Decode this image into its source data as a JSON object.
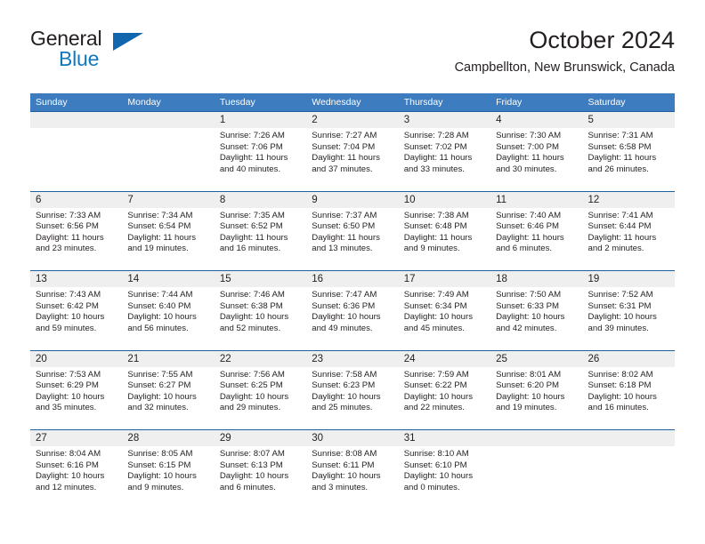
{
  "brand": {
    "word_one": "General",
    "word_two": "Blue",
    "triangle_icon": "triangle-icon",
    "accent_dark": "#1266ae",
    "accent_blue": "#1278be"
  },
  "header": {
    "title": "October 2024",
    "subtitle": "Campbellton, New Brunswick, Canada"
  },
  "theme": {
    "header_blue": "#3c7cbf",
    "row_divider_blue": "#1f5fa0",
    "daynum_band_gray": "#efefef",
    "text": "#231f20"
  },
  "weekdays": [
    "Sunday",
    "Monday",
    "Tuesday",
    "Wednesday",
    "Thursday",
    "Friday",
    "Saturday"
  ],
  "weeks": [
    [
      {
        "day": "",
        "sunrise": "",
        "sunset": "",
        "daylight1": "",
        "daylight2": ""
      },
      {
        "day": "",
        "sunrise": "",
        "sunset": "",
        "daylight1": "",
        "daylight2": ""
      },
      {
        "day": "1",
        "sunrise": "Sunrise: 7:26 AM",
        "sunset": "Sunset: 7:06 PM",
        "daylight1": "Daylight: 11 hours",
        "daylight2": "and 40 minutes."
      },
      {
        "day": "2",
        "sunrise": "Sunrise: 7:27 AM",
        "sunset": "Sunset: 7:04 PM",
        "daylight1": "Daylight: 11 hours",
        "daylight2": "and 37 minutes."
      },
      {
        "day": "3",
        "sunrise": "Sunrise: 7:28 AM",
        "sunset": "Sunset: 7:02 PM",
        "daylight1": "Daylight: 11 hours",
        "daylight2": "and 33 minutes."
      },
      {
        "day": "4",
        "sunrise": "Sunrise: 7:30 AM",
        "sunset": "Sunset: 7:00 PM",
        "daylight1": "Daylight: 11 hours",
        "daylight2": "and 30 minutes."
      },
      {
        "day": "5",
        "sunrise": "Sunrise: 7:31 AM",
        "sunset": "Sunset: 6:58 PM",
        "daylight1": "Daylight: 11 hours",
        "daylight2": "and 26 minutes."
      }
    ],
    [
      {
        "day": "6",
        "sunrise": "Sunrise: 7:33 AM",
        "sunset": "Sunset: 6:56 PM",
        "daylight1": "Daylight: 11 hours",
        "daylight2": "and 23 minutes."
      },
      {
        "day": "7",
        "sunrise": "Sunrise: 7:34 AM",
        "sunset": "Sunset: 6:54 PM",
        "daylight1": "Daylight: 11 hours",
        "daylight2": "and 19 minutes."
      },
      {
        "day": "8",
        "sunrise": "Sunrise: 7:35 AM",
        "sunset": "Sunset: 6:52 PM",
        "daylight1": "Daylight: 11 hours",
        "daylight2": "and 16 minutes."
      },
      {
        "day": "9",
        "sunrise": "Sunrise: 7:37 AM",
        "sunset": "Sunset: 6:50 PM",
        "daylight1": "Daylight: 11 hours",
        "daylight2": "and 13 minutes."
      },
      {
        "day": "10",
        "sunrise": "Sunrise: 7:38 AM",
        "sunset": "Sunset: 6:48 PM",
        "daylight1": "Daylight: 11 hours",
        "daylight2": "and 9 minutes."
      },
      {
        "day": "11",
        "sunrise": "Sunrise: 7:40 AM",
        "sunset": "Sunset: 6:46 PM",
        "daylight1": "Daylight: 11 hours",
        "daylight2": "and 6 minutes."
      },
      {
        "day": "12",
        "sunrise": "Sunrise: 7:41 AM",
        "sunset": "Sunset: 6:44 PM",
        "daylight1": "Daylight: 11 hours",
        "daylight2": "and 2 minutes."
      }
    ],
    [
      {
        "day": "13",
        "sunrise": "Sunrise: 7:43 AM",
        "sunset": "Sunset: 6:42 PM",
        "daylight1": "Daylight: 10 hours",
        "daylight2": "and 59 minutes."
      },
      {
        "day": "14",
        "sunrise": "Sunrise: 7:44 AM",
        "sunset": "Sunset: 6:40 PM",
        "daylight1": "Daylight: 10 hours",
        "daylight2": "and 56 minutes."
      },
      {
        "day": "15",
        "sunrise": "Sunrise: 7:46 AM",
        "sunset": "Sunset: 6:38 PM",
        "daylight1": "Daylight: 10 hours",
        "daylight2": "and 52 minutes."
      },
      {
        "day": "16",
        "sunrise": "Sunrise: 7:47 AM",
        "sunset": "Sunset: 6:36 PM",
        "daylight1": "Daylight: 10 hours",
        "daylight2": "and 49 minutes."
      },
      {
        "day": "17",
        "sunrise": "Sunrise: 7:49 AM",
        "sunset": "Sunset: 6:34 PM",
        "daylight1": "Daylight: 10 hours",
        "daylight2": "and 45 minutes."
      },
      {
        "day": "18",
        "sunrise": "Sunrise: 7:50 AM",
        "sunset": "Sunset: 6:33 PM",
        "daylight1": "Daylight: 10 hours",
        "daylight2": "and 42 minutes."
      },
      {
        "day": "19",
        "sunrise": "Sunrise: 7:52 AM",
        "sunset": "Sunset: 6:31 PM",
        "daylight1": "Daylight: 10 hours",
        "daylight2": "and 39 minutes."
      }
    ],
    [
      {
        "day": "20",
        "sunrise": "Sunrise: 7:53 AM",
        "sunset": "Sunset: 6:29 PM",
        "daylight1": "Daylight: 10 hours",
        "daylight2": "and 35 minutes."
      },
      {
        "day": "21",
        "sunrise": "Sunrise: 7:55 AM",
        "sunset": "Sunset: 6:27 PM",
        "daylight1": "Daylight: 10 hours",
        "daylight2": "and 32 minutes."
      },
      {
        "day": "22",
        "sunrise": "Sunrise: 7:56 AM",
        "sunset": "Sunset: 6:25 PM",
        "daylight1": "Daylight: 10 hours",
        "daylight2": "and 29 minutes."
      },
      {
        "day": "23",
        "sunrise": "Sunrise: 7:58 AM",
        "sunset": "Sunset: 6:23 PM",
        "daylight1": "Daylight: 10 hours",
        "daylight2": "and 25 minutes."
      },
      {
        "day": "24",
        "sunrise": "Sunrise: 7:59 AM",
        "sunset": "Sunset: 6:22 PM",
        "daylight1": "Daylight: 10 hours",
        "daylight2": "and 22 minutes."
      },
      {
        "day": "25",
        "sunrise": "Sunrise: 8:01 AM",
        "sunset": "Sunset: 6:20 PM",
        "daylight1": "Daylight: 10 hours",
        "daylight2": "and 19 minutes."
      },
      {
        "day": "26",
        "sunrise": "Sunrise: 8:02 AM",
        "sunset": "Sunset: 6:18 PM",
        "daylight1": "Daylight: 10 hours",
        "daylight2": "and 16 minutes."
      }
    ],
    [
      {
        "day": "27",
        "sunrise": "Sunrise: 8:04 AM",
        "sunset": "Sunset: 6:16 PM",
        "daylight1": "Daylight: 10 hours",
        "daylight2": "and 12 minutes."
      },
      {
        "day": "28",
        "sunrise": "Sunrise: 8:05 AM",
        "sunset": "Sunset: 6:15 PM",
        "daylight1": "Daylight: 10 hours",
        "daylight2": "and 9 minutes."
      },
      {
        "day": "29",
        "sunrise": "Sunrise: 8:07 AM",
        "sunset": "Sunset: 6:13 PM",
        "daylight1": "Daylight: 10 hours",
        "daylight2": "and 6 minutes."
      },
      {
        "day": "30",
        "sunrise": "Sunrise: 8:08 AM",
        "sunset": "Sunset: 6:11 PM",
        "daylight1": "Daylight: 10 hours",
        "daylight2": "and 3 minutes."
      },
      {
        "day": "31",
        "sunrise": "Sunrise: 8:10 AM",
        "sunset": "Sunset: 6:10 PM",
        "daylight1": "Daylight: 10 hours",
        "daylight2": "and 0 minutes."
      },
      {
        "day": "",
        "sunrise": "",
        "sunset": "",
        "daylight1": "",
        "daylight2": ""
      },
      {
        "day": "",
        "sunrise": "",
        "sunset": "",
        "daylight1": "",
        "daylight2": ""
      }
    ]
  ]
}
